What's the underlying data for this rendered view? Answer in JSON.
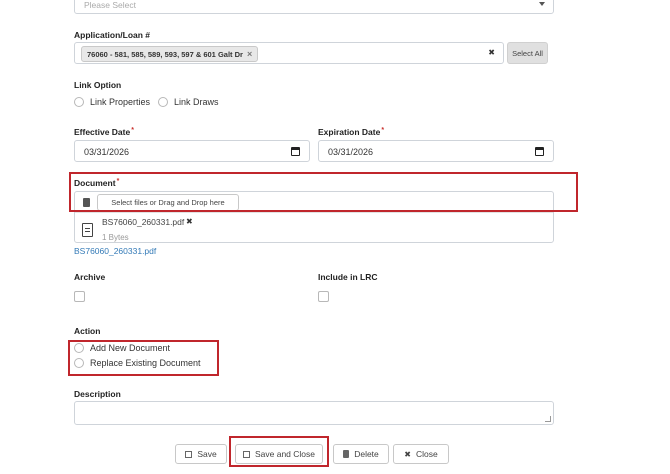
{
  "top_select": {
    "placeholder": "Please Select"
  },
  "application": {
    "label": "Application/Loan #",
    "tag": "76060 - 581, 585, 589, 593, 597 & 601 Galt Dr",
    "tag_remove": "×",
    "clear": "✖",
    "select_all": "Select All"
  },
  "link_option": {
    "label": "Link Option",
    "options": [
      "Link Properties",
      "Link Draws"
    ]
  },
  "effective_date": {
    "label": "Effective Date",
    "required": "*",
    "value": "03/31/2026"
  },
  "expiration_date": {
    "label": "Expiration Date",
    "required": "*",
    "value": "03/31/2026"
  },
  "document": {
    "label": "Document",
    "required": "*",
    "upload_label": "Select files or Drag and Drop here",
    "file_name": "BS76060_260331.pdf",
    "file_remove": "✖",
    "file_size": "1 Bytes",
    "file_link": "BS76060_260331.pdf"
  },
  "archive": {
    "label": "Archive"
  },
  "include_lrc": {
    "label": "Include in LRC"
  },
  "action": {
    "label": "Action",
    "options": [
      "Add New Document",
      "Replace Existing Document"
    ]
  },
  "description": {
    "label": "Description"
  },
  "footer": {
    "save": "Save",
    "save_close": "Save and Close",
    "delete": "Delete",
    "close": "Close"
  },
  "colors": {
    "highlight": "#c0262c",
    "link": "#337ab7",
    "select_all_bg": "#e0e0e0"
  }
}
